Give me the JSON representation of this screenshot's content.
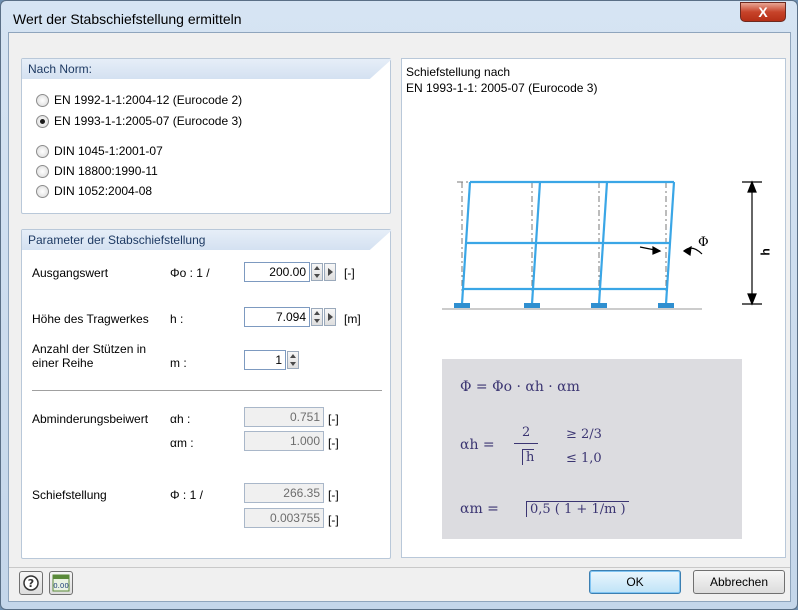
{
  "window": {
    "title": "Wert der Stabschiefstellung ermitteln",
    "close_label": "X"
  },
  "norm": {
    "header": "Nach Norm:",
    "options": [
      {
        "label": "EN 1992-1-1:2004-12 (Eurocode 2)",
        "checked": false
      },
      {
        "label": "EN 1993-1-1:2005-07 (Eurocode 3)",
        "checked": true
      },
      {
        "label": "DIN 1045-1:2001-07",
        "checked": false
      },
      {
        "label": "DIN 18800:1990-11",
        "checked": false
      },
      {
        "label": "DIN 1052:2004-08",
        "checked": false
      }
    ]
  },
  "params": {
    "header": "Parameter der Stabschiefstellung",
    "ausgangswert": {
      "label": "Ausgangswert",
      "symbol": "Φo : 1 /",
      "value": "200.00",
      "unit": "[-]"
    },
    "hoehe": {
      "label": "Höhe des Tragwerkes",
      "symbol": "h :",
      "value": "7.094",
      "unit": "[m]"
    },
    "stuetzen": {
      "label_line1": "Anzahl der Stützen in",
      "label_line2": "einer Reihe",
      "symbol": "m :",
      "value": "1"
    },
    "abminderung": {
      "label": "Abminderungsbeiwert",
      "alpha_h_symbol": "αh :",
      "alpha_h": "0.751",
      "alpha_m_symbol": "αm :",
      "alpha_m": "1.000",
      "unit": "[-]"
    },
    "schiefstellung": {
      "label": "Schiefstellung",
      "symbol": "Φ : 1 /",
      "value": "266.35",
      "value2": "0.003755",
      "unit": "[-]"
    }
  },
  "figure": {
    "caption_line1": "Schiefstellung nach",
    "caption_line2": "EN 1993-1-1: 2005-07  (Eurocode 3)",
    "phi_label": "Φ",
    "h_label": "h",
    "formula1": "Φ = Φo · αh · αm",
    "formula2_lhs": "αh =",
    "formula2_num": "2",
    "formula2_den": "h",
    "formula2_ge": "≥ 2/3",
    "formula2_le": "≤ 1,0",
    "formula3_lhs": "αm =",
    "formula3_rhs": "0,5 ( 1 + 1/m )"
  },
  "footer": {
    "ok_label": "OK",
    "cancel_label": "Abbrechen",
    "help_icon": "help-icon",
    "units_icon": "decimal-places-icon"
  }
}
